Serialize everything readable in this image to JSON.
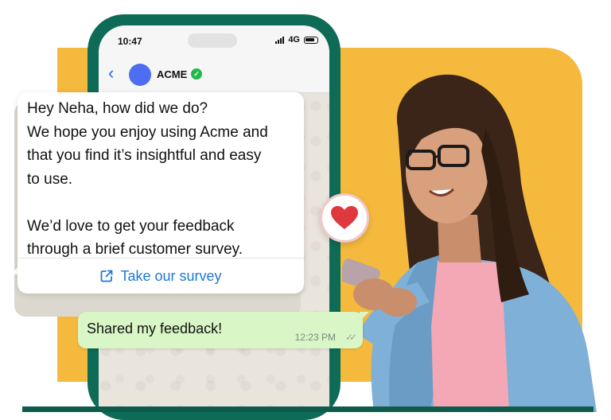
{
  "status_bar": {
    "time": "10:47",
    "network": "4G"
  },
  "chat": {
    "contact_name": "ACME",
    "incoming_message": "Hey Neha, how did we do?\nWe hope you enjoy using Acme and\nthat you find it’s insightful and easy\nto use.\n\nWe’d love to get your feedback\nthrough a brief customer survey.",
    "survey_link_label": "Take our survey",
    "reply_message": "Shared my feedback!",
    "reply_time": "12:23 PM",
    "reply_status_icon": "double-check-icon",
    "reaction_icon": "heart-icon"
  },
  "colors": {
    "phone_frame": "#0d6b56",
    "panel": "#f5b93e",
    "link": "#1e78d6",
    "outgoing_bubble": "#d8f6c6",
    "heart": "#e0383f",
    "verified": "#25b84a",
    "avatar": "#4e6ef2"
  }
}
